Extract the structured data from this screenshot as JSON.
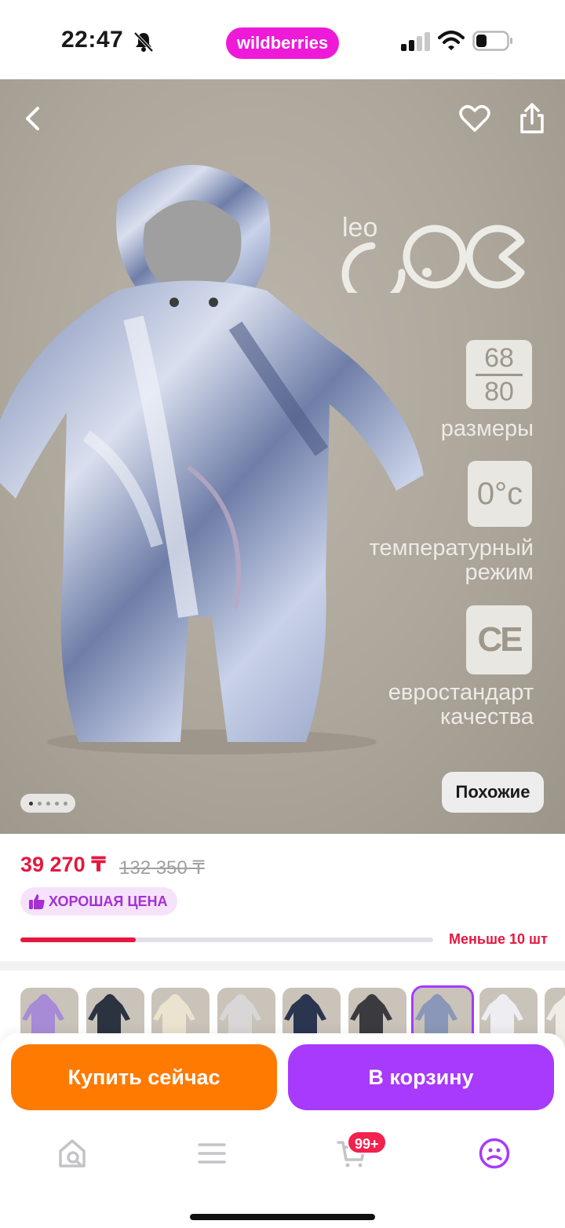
{
  "status_bar": {
    "time": "22:47",
    "app_badge": "wildberries",
    "icons": [
      "bell-slash-icon",
      "cellular-signal-icon",
      "wifi-icon",
      "battery-icon"
    ]
  },
  "gallery": {
    "icons": [
      "chevron-left-icon",
      "heart-icon",
      "share-icon"
    ],
    "brand_small": "leo",
    "features": [
      {
        "badge_top": "68",
        "badge_bottom": "80",
        "label_line1": "размеры",
        "label_line2": ""
      },
      {
        "badge": "0°c",
        "label_line1": "температурный",
        "label_line2": "режим"
      },
      {
        "badge": "CE",
        "label_line1": "евростандарт",
        "label_line2": "качества"
      }
    ],
    "similar_label": "Похожие",
    "page_count": 5,
    "active_page": 1
  },
  "price": {
    "current": "39 270 ₸",
    "old": "132 350 ₸",
    "good_price_badge": "ХОРОШАЯ ЦЕНА",
    "stock_text": "Меньше 10 шт",
    "stock_level": 0.28
  },
  "variants": {
    "selected_index": 6,
    "colors": [
      "#a88bd6",
      "#2c3340",
      "#ebe3cf",
      "#d9d6d8",
      "#2a3550",
      "#3b3b3f",
      "#8b97b8",
      "#eeeef2",
      "#f0ede6"
    ]
  },
  "actions": {
    "buy_now": "Купить сейчас",
    "add_to_cart": "В корзину"
  },
  "tabbar": {
    "icons": [
      "home-search-icon",
      "menu-icon",
      "cart-icon",
      "profile-icon"
    ],
    "cart_badge": "99+",
    "active_tab": "profile"
  },
  "colors": {
    "accent_purple": "#a73afd",
    "buy_orange": "#ff7a00",
    "price_red": "#e5173f",
    "brand_pink": "#ee1ad7"
  }
}
